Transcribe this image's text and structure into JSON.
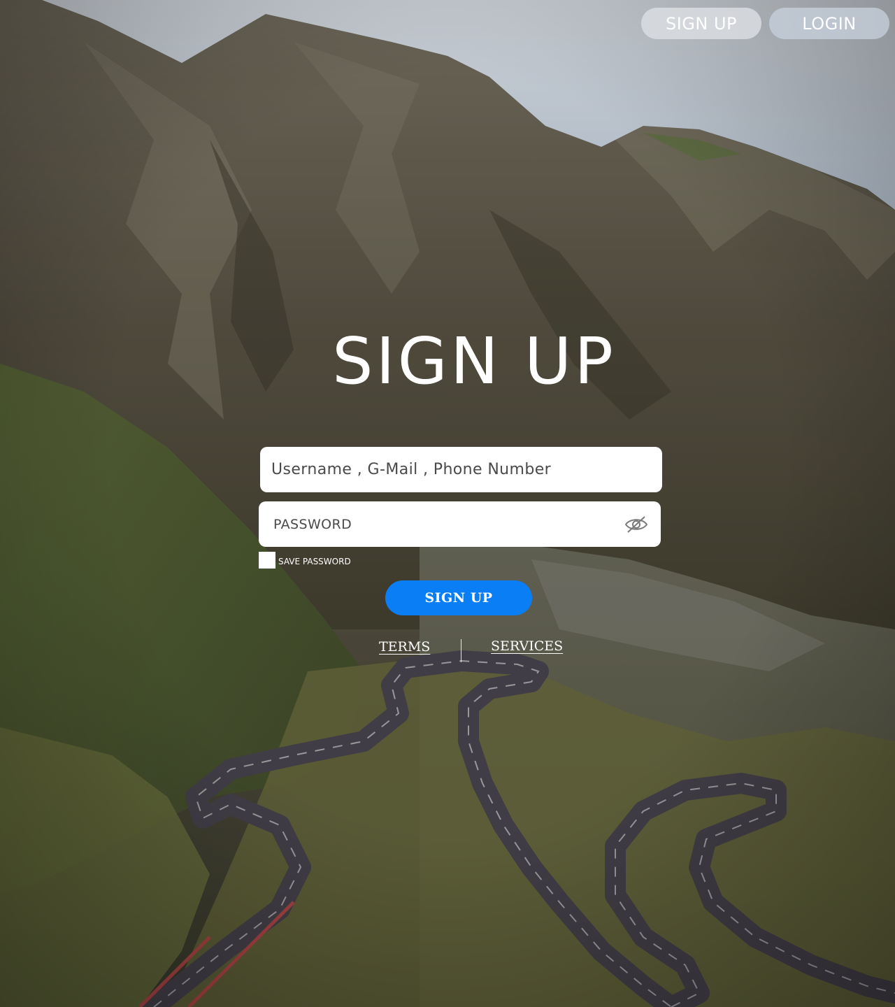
{
  "nav": {
    "signup_label": "SIGN UP",
    "login_label": "LOGIN"
  },
  "title": "SIGN UP",
  "form": {
    "username_placeholder": "Username , G-Mail , Phone Number",
    "password_placeholder": "PASSWORD",
    "save_password_label": "SAVE PASSWORD",
    "save_password_checked": false,
    "submit_label": "SIGN UP"
  },
  "footer_links": {
    "terms": "TERMS",
    "services": "SERVICES"
  },
  "icons": {
    "password_toggle": "eye-slash-icon",
    "background": "mountain-road-photo"
  },
  "colors": {
    "primary": "#0a7ef5",
    "text_light": "#ffffff",
    "field_bg": "#ffffff"
  }
}
